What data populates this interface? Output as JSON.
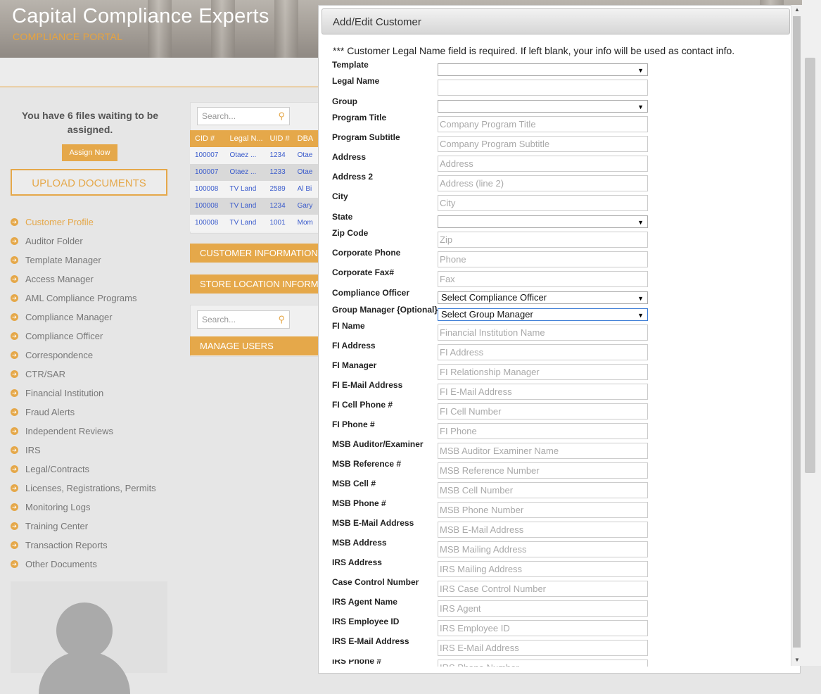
{
  "brand": {
    "title": "Capital Compliance Experts",
    "subtitle": "COMPLIANCE PORTAL"
  },
  "left": {
    "waiting_text": "You have 6 files waiting to be assigned.",
    "assign_button": "Assign Now",
    "upload_button": "UPLOAD DOCUMENTS",
    "nav": [
      "Customer Profile",
      "Auditor Folder",
      "Template Manager",
      "Access Manager",
      "AML Compliance Programs",
      "Compliance Manager",
      "Compliance Officer",
      "Correspondence",
      "CTR/SAR",
      "Financial Institution",
      "Fraud Alerts",
      "Independent Reviews",
      "IRS",
      "Legal/Contracts",
      "Licenses, Registrations, Permits",
      "Monitoring Logs",
      "Training Center",
      "Transaction Reports",
      "Other Documents"
    ],
    "active_nav": "Customer Profile"
  },
  "table": {
    "search_placeholder": "Search...",
    "headers": [
      "CID #",
      "Legal N...",
      "UID #",
      "DBA"
    ],
    "rows": [
      [
        "100007",
        "Otaez ...",
        "1234",
        "Otae"
      ],
      [
        "100007",
        "Otaez ...",
        "1233",
        "Otae"
      ],
      [
        "100008",
        "TV Land",
        "2589",
        "Al Bi"
      ],
      [
        "100008",
        "TV Land",
        "1234",
        "Gary"
      ],
      [
        "100008",
        "TV Land",
        "1001",
        "Mom"
      ]
    ]
  },
  "sections": {
    "customer_info": "CUSTOMER INFORMATION",
    "store_location": "STORE LOCATION INFORM",
    "users_search_placeholder": "Search...",
    "manage_users": "MANAGE USERS"
  },
  "modal": {
    "title": "Add/Edit Customer",
    "notice": "*** Customer Legal Name field is required. If left blank, your info will be used as contact info.",
    "fields": {
      "template": {
        "label": "Template",
        "value": ""
      },
      "legal_name": {
        "label": "Legal Name",
        "placeholder": ""
      },
      "group": {
        "label": "Group",
        "value": ""
      },
      "program_title": {
        "label": "Program Title",
        "placeholder": "Company Program Title"
      },
      "program_subtitle": {
        "label": "Program Subtitle",
        "placeholder": "Company Program Subtitle"
      },
      "address": {
        "label": "Address",
        "placeholder": "Address"
      },
      "address2": {
        "label": "Address 2",
        "placeholder": "Address (line 2)"
      },
      "city": {
        "label": "City",
        "placeholder": "City"
      },
      "state": {
        "label": "State",
        "value": ""
      },
      "zip": {
        "label": "Zip Code",
        "placeholder": "Zip"
      },
      "corp_phone": {
        "label": "Corporate Phone",
        "placeholder": "Phone"
      },
      "corp_fax": {
        "label": "Corporate Fax#",
        "placeholder": "Fax"
      },
      "compliance_officer": {
        "label": "Compliance Officer",
        "value": "Select Compliance Officer"
      },
      "group_manager": {
        "label": "Group Manager {Optional}",
        "value": "Select Group Manager"
      },
      "fi_name": {
        "label": "FI Name",
        "placeholder": "Financial Institution Name"
      },
      "fi_address": {
        "label": "FI Address",
        "placeholder": "FI Address"
      },
      "fi_manager": {
        "label": "FI Manager",
        "placeholder": "FI Relationship Manager"
      },
      "fi_email": {
        "label": "FI E-Mail Address",
        "placeholder": "FI E-Mail Address"
      },
      "fi_cell": {
        "label": "FI Cell Phone #",
        "placeholder": "FI Cell Number"
      },
      "fi_phone": {
        "label": "FI Phone #",
        "placeholder": "FI Phone"
      },
      "msb_auditor": {
        "label": "MSB Auditor/Examiner",
        "placeholder": "MSB Auditor Examiner Name"
      },
      "msb_ref": {
        "label": "MSB Reference #",
        "placeholder": "MSB Reference Number"
      },
      "msb_cell": {
        "label": "MSB Cell #",
        "placeholder": "MSB Cell Number"
      },
      "msb_phone": {
        "label": "MSB Phone #",
        "placeholder": "MSB Phone Number"
      },
      "msb_email": {
        "label": "MSB E-Mail Address",
        "placeholder": "MSB E-Mail Address"
      },
      "msb_address": {
        "label": "MSB Address",
        "placeholder": "MSB Mailing Address"
      },
      "irs_address": {
        "label": "IRS Address",
        "placeholder": "IRS Mailing Address"
      },
      "case_control": {
        "label": "Case Control Number",
        "placeholder": "IRS Case Control Number"
      },
      "irs_agent": {
        "label": "IRS Agent Name",
        "placeholder": "IRS Agent"
      },
      "irs_employee": {
        "label": "IRS Employee ID",
        "placeholder": "IRS Employee ID"
      },
      "irs_email": {
        "label": "IRS E-Mail Address",
        "placeholder": "IRS E-Mail Address"
      },
      "irs_phone": {
        "label": "IRS Phone #",
        "placeholder": "IRS Phone Number"
      }
    }
  }
}
